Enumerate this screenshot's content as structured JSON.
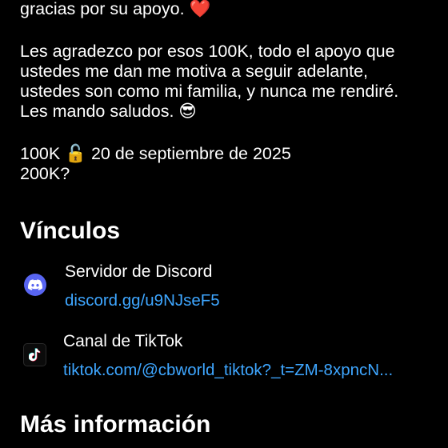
{
  "about": {
    "line_top_text": "gracias por su apoyo.",
    "line_top_emoji": "❤️",
    "thanks_text": "Les agradezco por esos 100K, todo el apoyo que\nustedes me dan me motiva a seguir adelante,\nustedes son como mi familia, y nunca me rendiré.\nLes mando saludos.",
    "thanks_emoji": "😎",
    "milestone_1_prefix": "100K",
    "milestone_1_emoji": "🔓",
    "milestone_1_date": "20 de septiembre de 2025",
    "milestone_2": "200K?"
  },
  "links_section": {
    "title": "Vínculos",
    "items": [
      {
        "name": "Servidor de Discord",
        "url": "discord.gg/u9NJseF5",
        "icon": "discord-icon"
      },
      {
        "name": "Canal de TikTok",
        "url": "tiktok.com/@cbworld_tiktok?_t=ZM-8xpncN...",
        "icon": "tiktok-icon"
      }
    ]
  },
  "more_info_section": {
    "title": "Más información"
  },
  "colors": {
    "background": "#000000",
    "text": "#ffffff",
    "link": "#3ea6ff",
    "discord_brand": "#5865f2"
  }
}
